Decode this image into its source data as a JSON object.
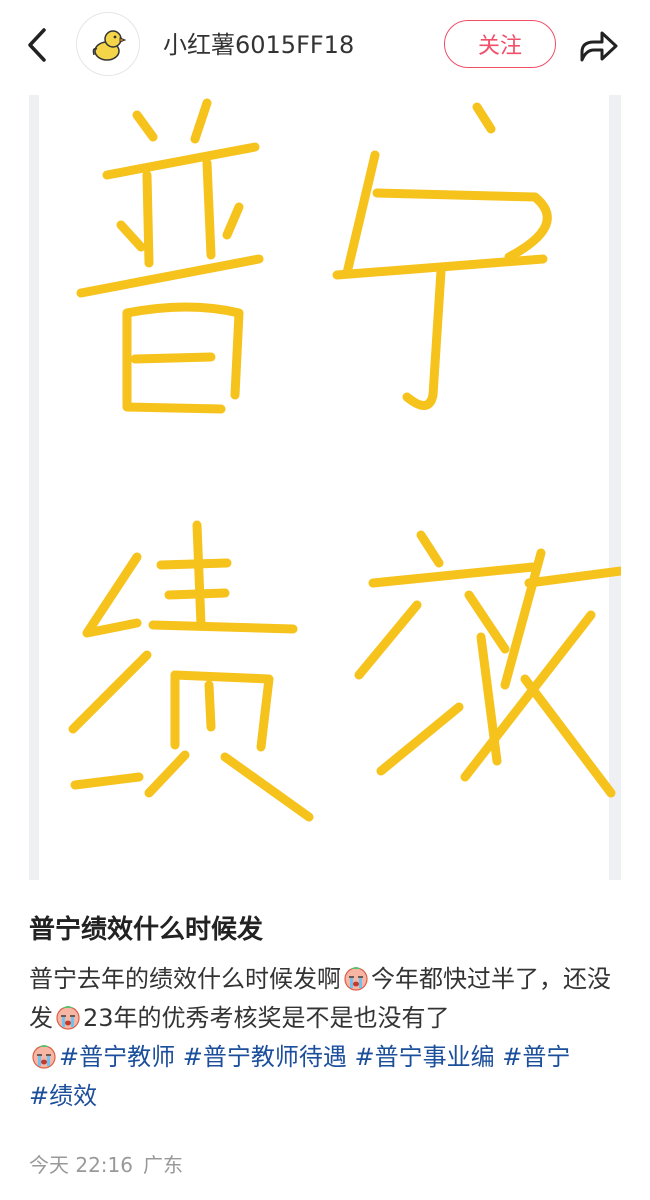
{
  "header": {
    "back_icon": "chevron-left-icon",
    "avatar_icon": "duck-avatar-icon",
    "username": "小红薯6015FF18",
    "follow_label": "关注",
    "share_icon": "share-arrow-icon",
    "accent_color": "#f0506a"
  },
  "media": {
    "handwritten_text": "普宁绩效",
    "stroke_color": "#f6c21c"
  },
  "note": {
    "title": "普宁绩效什么时候发",
    "desc_part1": "普宁去年的绩效什么时候发啊",
    "desc_part2": "今年都快过半了，还没发",
    "desc_part3": "23年的优秀考核奖是不是也没有了",
    "emoji_icon": "crying-face-emoji",
    "tags": [
      "#普宁教师",
      "#普宁教师待遇",
      "#普宁事业编",
      "#普宁",
      "#绩效"
    ],
    "tag_color": "#1b4e9b"
  },
  "meta": {
    "time": "今天 22:16",
    "location": "广东"
  }
}
